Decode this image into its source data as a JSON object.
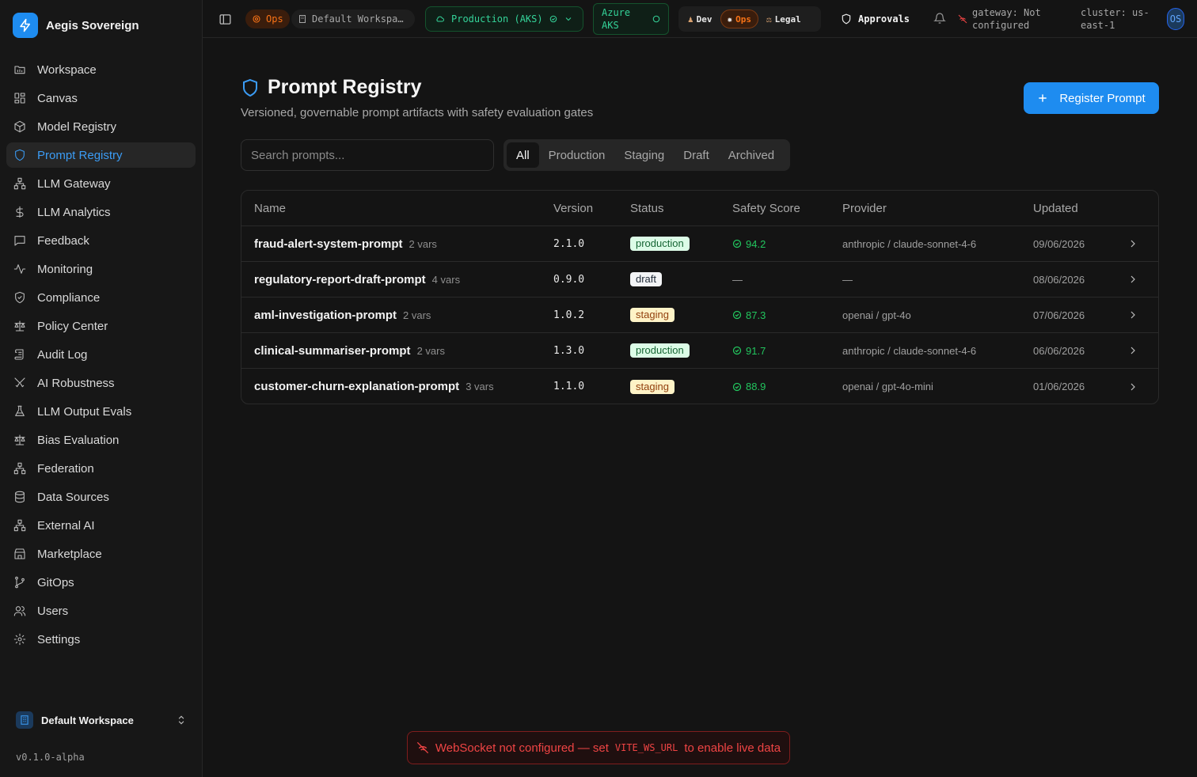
{
  "brand": {
    "name": "Aegis Sovereign"
  },
  "sidebar": {
    "items": [
      {
        "label": "Workspace",
        "icon": "folder-icon"
      },
      {
        "label": "Canvas",
        "icon": "grid-icon"
      },
      {
        "label": "Model Registry",
        "icon": "box-icon"
      },
      {
        "label": "Prompt Registry",
        "icon": "shield-icon",
        "active": true
      },
      {
        "label": "LLM Gateway",
        "icon": "network-icon"
      },
      {
        "label": "LLM Analytics",
        "icon": "dollar-icon"
      },
      {
        "label": "Feedback",
        "icon": "message-icon"
      },
      {
        "label": "Monitoring",
        "icon": "activity-icon"
      },
      {
        "label": "Compliance",
        "icon": "shield-check-icon"
      },
      {
        "label": "Policy Center",
        "icon": "scale-icon"
      },
      {
        "label": "Audit Log",
        "icon": "scroll-icon"
      },
      {
        "label": "AI Robustness",
        "icon": "swords-icon"
      },
      {
        "label": "LLM Output Evals",
        "icon": "flask-icon"
      },
      {
        "label": "Bias Evaluation",
        "icon": "scale-icon"
      },
      {
        "label": "Federation",
        "icon": "network-icon"
      },
      {
        "label": "Data Sources",
        "icon": "database-icon"
      },
      {
        "label": "External AI",
        "icon": "network-icon"
      },
      {
        "label": "Marketplace",
        "icon": "store-icon"
      },
      {
        "label": "GitOps",
        "icon": "git-branch-icon"
      },
      {
        "label": "Users",
        "icon": "users-icon"
      },
      {
        "label": "Settings",
        "icon": "gear-icon"
      }
    ],
    "workspace": "Default Workspace",
    "version": "v0.1.0-alpha"
  },
  "topbar": {
    "role_badge": "Ops",
    "workspace": "Default Workspa…",
    "environment": "Production (AKS)",
    "cloud_line1": "Azure",
    "cloud_line2": "AKS",
    "personas": [
      "Dev",
      "Ops",
      "Legal"
    ],
    "approvals": "Approvals",
    "gateway_line1": "gateway: Not",
    "gateway_line2": "configured",
    "cluster_line1": "cluster: us-",
    "cluster_line2": "east-1",
    "avatar": "OS"
  },
  "page": {
    "title": "Prompt Registry",
    "subtitle": "Versioned, governable prompt artifacts with safety evaluation gates",
    "register_button": "Register Prompt",
    "search_placeholder": "Search prompts...",
    "tabs": [
      "All",
      "Production",
      "Staging",
      "Draft",
      "Archived"
    ],
    "active_tab": "All"
  },
  "table": {
    "headers": [
      "Name",
      "Version",
      "Status",
      "Safety Score",
      "Provider",
      "Updated"
    ],
    "rows": [
      {
        "name": "fraud-alert-system-prompt",
        "vars": "2 vars",
        "version": "2.1.0",
        "status": "production",
        "score": "94.2",
        "provider": "anthropic / claude-sonnet-4-6",
        "updated": "09/06/2026"
      },
      {
        "name": "regulatory-report-draft-prompt",
        "vars": "4 vars",
        "version": "0.9.0",
        "status": "draft",
        "score": "—",
        "provider": "—",
        "updated": "08/06/2026"
      },
      {
        "name": "aml-investigation-prompt",
        "vars": "2 vars",
        "version": "1.0.2",
        "status": "staging",
        "score": "87.3",
        "provider": "openai / gpt-4o",
        "updated": "07/06/2026"
      },
      {
        "name": "clinical-summariser-prompt",
        "vars": "2 vars",
        "version": "1.3.0",
        "status": "production",
        "score": "91.7",
        "provider": "anthropic / claude-sonnet-4-6",
        "updated": "06/06/2026"
      },
      {
        "name": "customer-churn-explanation-prompt",
        "vars": "3 vars",
        "version": "1.1.0",
        "status": "staging",
        "score": "88.9",
        "provider": "openai / gpt-4o-mini",
        "updated": "01/06/2026"
      }
    ]
  },
  "toast": {
    "text_before": "WebSocket not configured — set",
    "code": "VITE_WS_URL",
    "text_after": "to enable live data"
  },
  "colors": {
    "accent": "#1e8cf0",
    "success": "#22c55e",
    "error": "#ef4444"
  }
}
